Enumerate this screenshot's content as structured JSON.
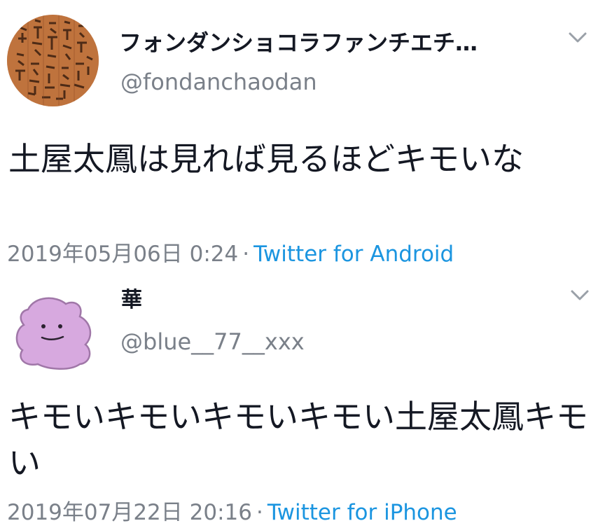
{
  "tweets": [
    {
      "display_name": "フォンダンショコラファンチエチ…",
      "handle": "@fondanchaodan",
      "avatar_icon": "scroll-calligraphy-avatar-icon",
      "menu_icon": "chevron-down-icon",
      "text": "土屋太鳳は見れば見るほどキモいな",
      "date": "2019年05月06日 0:24",
      "separator": "·",
      "source": "Twitter for Android"
    },
    {
      "display_name": "華",
      "handle": "@blue__77__xxx",
      "avatar_icon": "pink-blob-avatar-icon",
      "menu_icon": "chevron-down-icon",
      "text": "キモいキモいキモいキモい土屋太鳳キモい",
      "date": "2019年07月22日 20:16",
      "separator": "·",
      "source": "Twitter for iPhone"
    }
  ],
  "colors": {
    "text": "#141823",
    "secondary_text": "#7a8089",
    "link": "#1b95e0",
    "avatar_blob": "#d7a9df"
  }
}
